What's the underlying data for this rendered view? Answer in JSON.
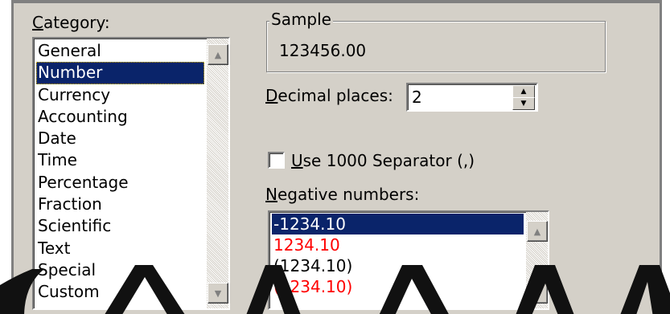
{
  "category": {
    "label": "Category:",
    "underline_char": "C",
    "items": [
      "General",
      "Number",
      "Currency",
      "Accounting",
      "Date",
      "Time",
      "Percentage",
      "Fraction",
      "Scientific",
      "Text",
      "Special",
      "Custom"
    ],
    "selected": "Number"
  },
  "sample": {
    "title": "Sample",
    "value": "123456.00"
  },
  "decimal_places": {
    "label": "Decimal places:",
    "underline_char": "D",
    "value": "2"
  },
  "separator": {
    "label": "Use 1000 Separator (,)",
    "underline_char": "U",
    "checked": false
  },
  "negative_numbers": {
    "label": "Negative numbers:",
    "underline_char": "N",
    "items": [
      {
        "text": "-1234.10",
        "color": "#000000"
      },
      {
        "text": "1234.10",
        "color": "#ff0000"
      },
      {
        "text": "(1234.10)",
        "color": "#000000"
      },
      {
        "text": "(1234.10)",
        "color": "#ff0000"
      }
    ],
    "selected_index": 0
  },
  "colors": {
    "dialog_face": "#d4d0c8",
    "selection": "#0a246a",
    "negative_red": "#ff0000"
  }
}
